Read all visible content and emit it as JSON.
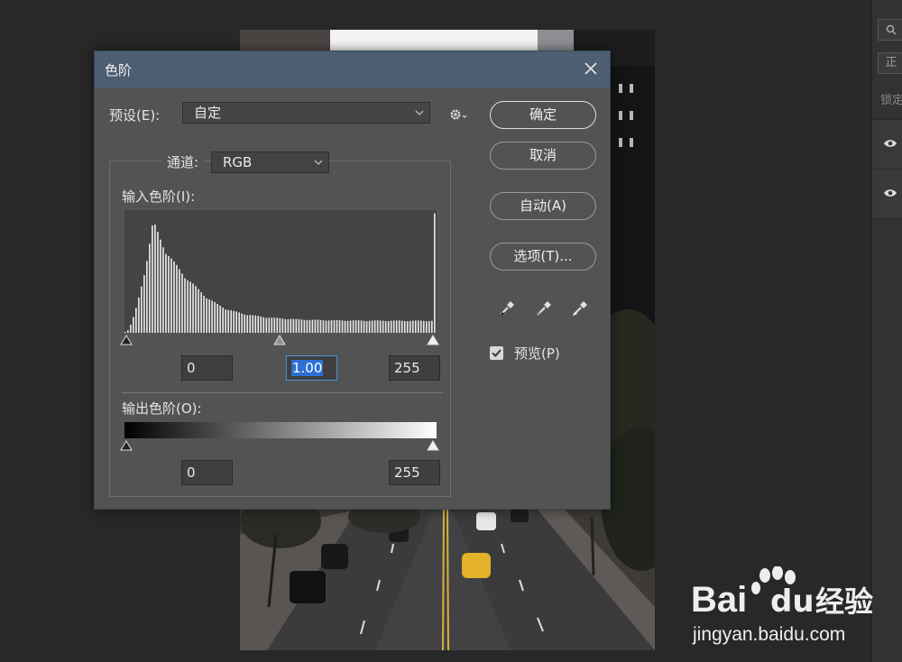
{
  "dialog": {
    "title": "色阶",
    "preset_label": "预设(E):",
    "preset_value": "自定",
    "channel_label": "通道:",
    "channel_value": "RGB",
    "input_levels_label": "输入色阶(I):",
    "input_black": "0",
    "input_gamma": "1.00",
    "input_white": "255",
    "output_levels_label": "输出色阶(O):",
    "output_black": "0",
    "output_white": "255",
    "buttons": {
      "ok": "确定",
      "cancel": "取消",
      "auto": "自动(A)",
      "options": "选项(T)..."
    },
    "preview_label": "预览(P)",
    "preview_checked": true
  },
  "right_panel": {
    "blend_mode": "正",
    "lock_label": "锁定"
  },
  "watermark": {
    "brand": "Bai",
    "brand_suffix": "经验",
    "url": "jingyan.baidu.com"
  },
  "colors": {
    "title_bar": "#4d5d72",
    "dialog_bg": "#535353",
    "app_bg": "#282828",
    "selection": "#2c6fd6"
  }
}
